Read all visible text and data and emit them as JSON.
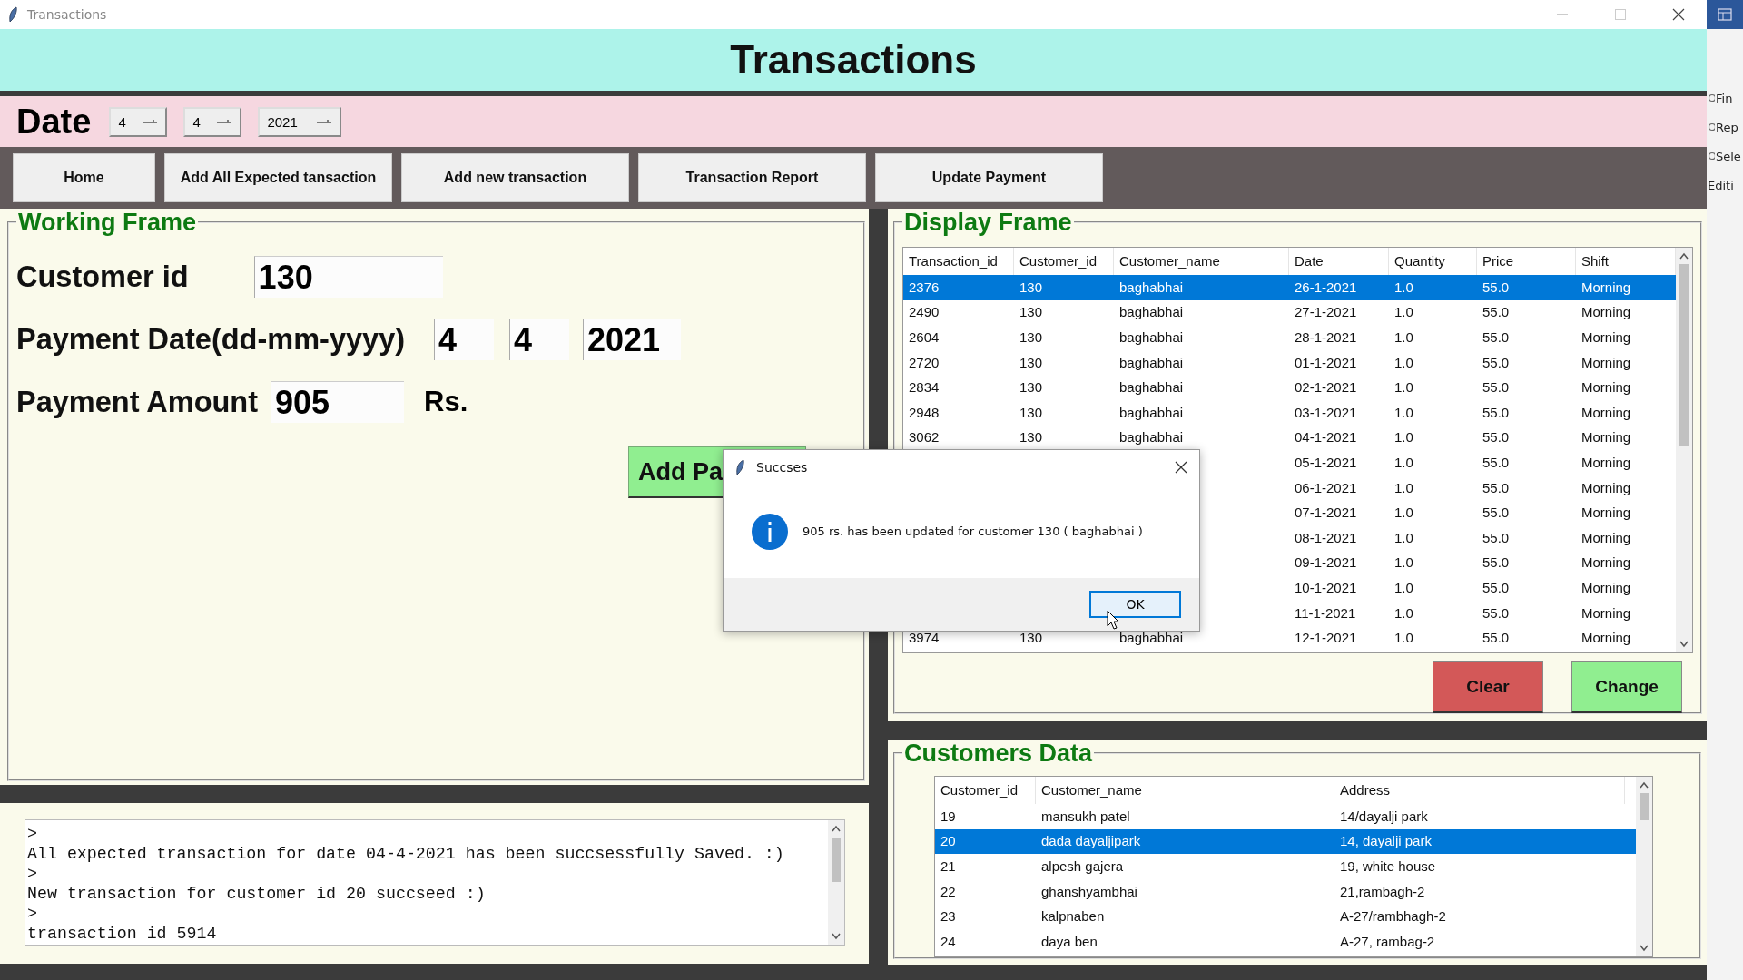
{
  "window": {
    "title": "Transactions"
  },
  "header": {
    "title": "Transactions"
  },
  "date_bar": {
    "label": "Date",
    "selectors": [
      {
        "value": "4"
      },
      {
        "value": "4"
      },
      {
        "value": "2021"
      }
    ]
  },
  "nav_buttons": [
    {
      "label": "Home"
    },
    {
      "label": "Add All Expected tansaction"
    },
    {
      "label": "Add new transaction"
    },
    {
      "label": "Transaction Report"
    },
    {
      "label": "Update Payment"
    }
  ],
  "working_frame": {
    "title": "Working Frame",
    "fields": [
      {
        "label": "Customer id",
        "values": [
          "130"
        ]
      },
      {
        "label": "Payment Date(dd-mm-yyyy)",
        "values": [
          "4",
          "4",
          "2021"
        ]
      },
      {
        "label": "Payment Amount",
        "values": [
          "905"
        ],
        "unit": "Rs."
      }
    ],
    "action_button": {
      "label": "Add Pa"
    }
  },
  "console": {
    "lines": [
      ">",
      "All expected transaction for date 04-4-2021 has been succsessfully Saved. :)",
      ">",
      "New transaction for customer id 20 succseed :)",
      ">",
      "transaction id 5914"
    ]
  },
  "display_frame": {
    "title": "Display Frame",
    "columns": [
      "Transaction_id",
      "Customer_id",
      "Customer_name",
      "Date",
      "Quantity",
      "Price",
      "Shift"
    ],
    "rows": [
      {
        "selected": true,
        "cells": [
          "2376",
          "130",
          "baghabhai",
          "26-1-2021",
          "1.0",
          "55.0",
          "Morning"
        ]
      },
      {
        "selected": false,
        "cells": [
          "2490",
          "130",
          "baghabhai",
          "27-1-2021",
          "1.0",
          "55.0",
          "Morning"
        ]
      },
      {
        "selected": false,
        "cells": [
          "2604",
          "130",
          "baghabhai",
          "28-1-2021",
          "1.0",
          "55.0",
          "Morning"
        ]
      },
      {
        "selected": false,
        "cells": [
          "2720",
          "130",
          "baghabhai",
          "01-1-2021",
          "1.0",
          "55.0",
          "Morning"
        ]
      },
      {
        "selected": false,
        "cells": [
          "2834",
          "130",
          "baghabhai",
          "02-1-2021",
          "1.0",
          "55.0",
          "Morning"
        ]
      },
      {
        "selected": false,
        "cells": [
          "2948",
          "130",
          "baghabhai",
          "03-1-2021",
          "1.0",
          "55.0",
          "Morning"
        ]
      },
      {
        "selected": false,
        "cells": [
          "3062",
          "130",
          "baghabhai",
          "04-1-2021",
          "1.0",
          "55.0",
          "Morning"
        ]
      },
      {
        "selected": false,
        "cells": [
          null,
          null,
          null,
          "05-1-2021",
          "1.0",
          "55.0",
          "Morning"
        ]
      },
      {
        "selected": false,
        "cells": [
          null,
          null,
          null,
          "06-1-2021",
          "1.0",
          "55.0",
          "Morning"
        ]
      },
      {
        "selected": false,
        "cells": [
          null,
          null,
          null,
          "07-1-2021",
          "1.0",
          "55.0",
          "Morning"
        ]
      },
      {
        "selected": false,
        "cells": [
          null,
          null,
          null,
          "08-1-2021",
          "1.0",
          "55.0",
          "Morning"
        ]
      },
      {
        "selected": false,
        "cells": [
          null,
          null,
          null,
          "09-1-2021",
          "1.0",
          "55.0",
          "Morning"
        ]
      },
      {
        "selected": false,
        "cells": [
          null,
          null,
          null,
          "10-1-2021",
          "1.0",
          "55.0",
          "Morning"
        ]
      },
      {
        "selected": false,
        "cells": [
          null,
          null,
          null,
          "11-1-2021",
          "1.0",
          "55.0",
          "Morning"
        ]
      },
      {
        "selected": false,
        "cells": [
          "3974",
          "130",
          "baghabhai",
          "12-1-2021",
          "1.0",
          "55.0",
          "Morning"
        ]
      }
    ],
    "buttons": [
      {
        "label": "Clear",
        "kind": "danger"
      },
      {
        "label": "Change",
        "kind": "confirm"
      }
    ]
  },
  "customers_frame": {
    "title": "Customers Data",
    "columns": [
      "Customer_id",
      "Customer_name",
      "Address"
    ],
    "rows": [
      {
        "selected": false,
        "cells": [
          "19",
          "mansukh patel",
          "14/dayalji park"
        ]
      },
      {
        "selected": true,
        "cells": [
          "20",
          "dada dayaljipark",
          "14, dayalji park"
        ]
      },
      {
        "selected": false,
        "cells": [
          "21",
          "alpesh gajera",
          "19, white house"
        ]
      },
      {
        "selected": false,
        "cells": [
          "22",
          "ghanshyambhai",
          "21,rambagh-2"
        ]
      },
      {
        "selected": false,
        "cells": [
          "23",
          "kalpnaben",
          "A-27/rambhagh-2"
        ]
      },
      {
        "selected": false,
        "cells": [
          "24",
          "daya ben",
          "A-27, rambag-2"
        ]
      }
    ]
  },
  "dialog": {
    "title": "Succses",
    "message": "905 rs. has been updated for customer 130 ( baghabhai )",
    "button": "OK"
  },
  "background_window": {
    "items": [
      "Fin",
      "Rep",
      "Sele",
      "Editi"
    ]
  }
}
